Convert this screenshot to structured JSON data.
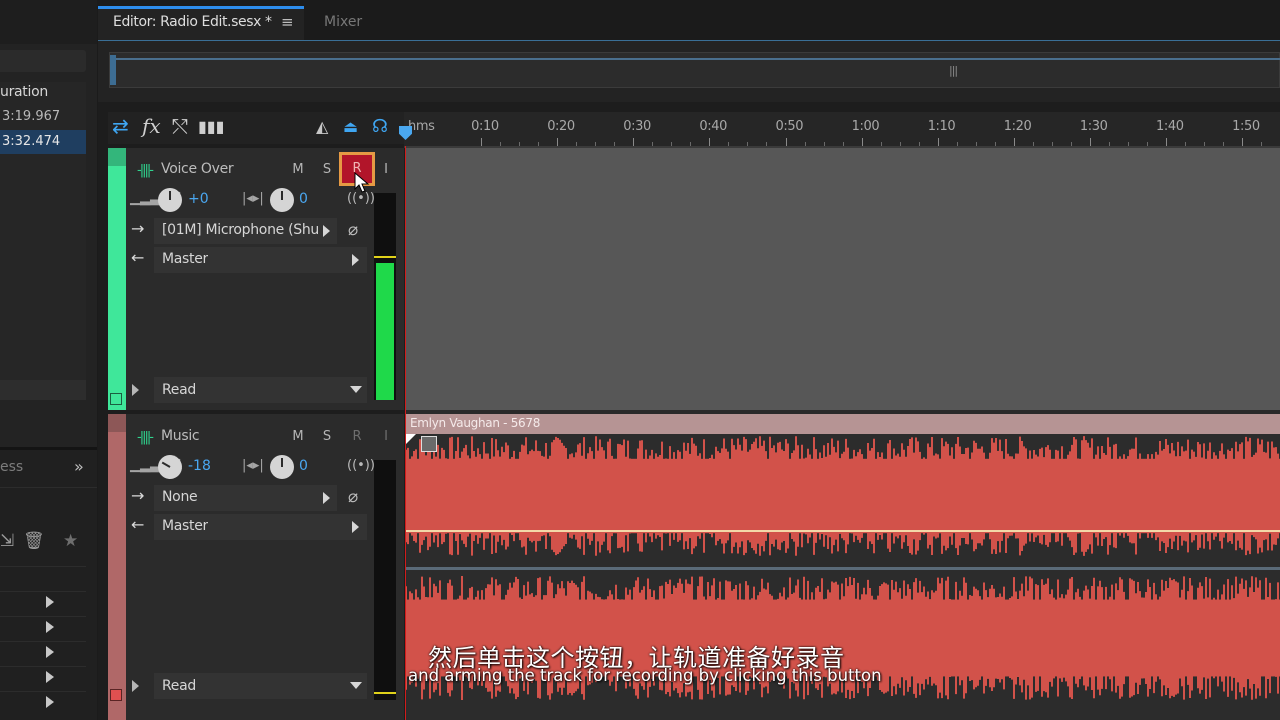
{
  "left_panel": {
    "column_header": "uration",
    "file_rows": [
      "3:19.967",
      "3:32.474"
    ],
    "history_tab": "ess",
    "panel_menu_icon": "»",
    "toolbar_icons": [
      "import-icon",
      "trash-icon",
      "star-icon"
    ]
  },
  "tabs": {
    "editor_label": "Editor: Radio Edit.sesx *",
    "editor_menu": "≡",
    "mixer_label": "Mixer"
  },
  "overview": {
    "grip": "|||"
  },
  "ruler": {
    "labels": [
      "hms",
      "0:10",
      "0:20",
      "0:30",
      "0:40",
      "0:50",
      "1:00",
      "1:10",
      "1:20",
      "1:30",
      "1:40",
      "1:50"
    ]
  },
  "toolbar": {
    "fx_label": "fx"
  },
  "tracks": [
    {
      "name": "Voice Over",
      "color": "#3fe79a",
      "mute": "M",
      "solo": "S",
      "record": "R",
      "input": "I",
      "record_armed": true,
      "volume": "+0",
      "pan": "0",
      "input_route": "[01M] Microphone (Shu",
      "output_route": "Master",
      "automation": "Read",
      "meter_level": 0.55
    },
    {
      "name": "Music",
      "color": "#b06868",
      "mute": "M",
      "solo": "S",
      "record": "R",
      "input": "I",
      "record_armed": false,
      "volume": "-18",
      "pan": "0",
      "input_route": "None",
      "output_route": "Master",
      "automation": "Read",
      "clip_name": "Emlyn Vaughan - 5678",
      "meter_level": 0.0
    }
  ],
  "subtitles": {
    "cn": "然后单击这个按钮，让轨道准备好录音",
    "en": "and arming the track for recording by clicking this button"
  },
  "colors": {
    "accent": "#2d8ceb",
    "playhead": "#4aa8f0",
    "waveform": "#d2524a",
    "record_button": "#b2152a",
    "highlight": "#e69a44"
  }
}
